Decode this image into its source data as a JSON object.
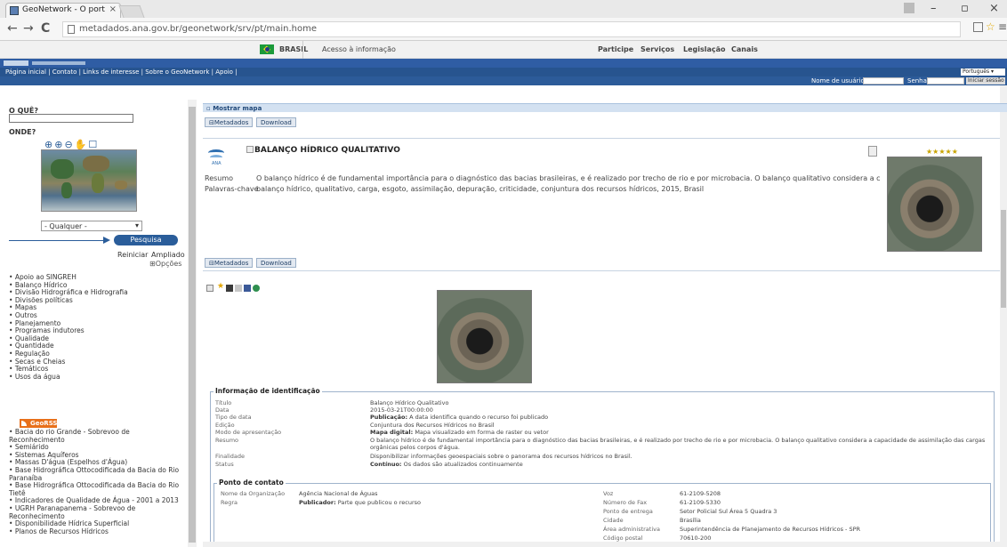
{
  "browser": {
    "tab_title": "GeoNetwork - O port",
    "url": "metadados.ana.gov.br/geonetwork/srv/pt/main.home"
  },
  "govbar": {
    "brasil": "BRASIL",
    "acesso": "Acesso à informação",
    "links": [
      "Participe",
      "Serviços",
      "Legislação",
      "Canais"
    ]
  },
  "header": {
    "nav": "Página inicial | Contato | Links de interesse | Sobre o GeoNetwork | Apoio |",
    "lang": "Português",
    "user_label": "Nome de usuário",
    "pass_label": "Senha",
    "login_label": "Iniciar sessão"
  },
  "sidebar": {
    "what": "O QUÊ?",
    "where": "ONDE?",
    "region": "- Qualquer -",
    "search": "Pesquisa",
    "reset": "Reiniciar",
    "advanced": "Ampliado",
    "options": "⊞Opções",
    "categories": [
      "Apoio ao SINGREH",
      "Balanço Hídrico",
      "Divisão Hidrográfica e Hidrografia",
      "Divisões políticas",
      "Mapas",
      "Outros",
      "Planejamento",
      "Programas indutores",
      "Qualidade",
      "Quantidade",
      "Regulação",
      "Secas e Cheias",
      "Temáticos",
      "Usos da água"
    ],
    "georss": "GeoRSS",
    "feeds": [
      "Bacia do rio Grande - Sobrevoo de Reconhecimento",
      "Semiárido",
      "Sistemas Aquíferos",
      "Massas D'água (Espelhos d'Água)",
      "Base Hidrográfica Ottocodificada da Bacia do Rio Paranaíba",
      "Base Hidrográfica Ottocodificada da Bacia do Rio Tietê",
      "Indicadores de Qualidade de Água - 2001 a 2013",
      "UGRH Paranapanema - Sobrevoo de Reconhecimento",
      "Disponibilidade Hídrica Superficial",
      "Planos de Recursos Hídricos"
    ]
  },
  "main": {
    "show_map": "Mostrar mapa",
    "metadados": "Metadados",
    "download": "Download",
    "logo_text": "ANA",
    "title": "BALANÇO HÍDRICO QUALITATIVO",
    "stars": "★★★★★",
    "resumo_label": "Resumo",
    "resumo": "O balanço hídrico é de fundamental importância para o diagnóstico das bacias brasileiras, e é realizado por trecho de rio e por microbacia. O balanço qualitativo considera a capacidade de assimilação...",
    "keywords_label": "Palavras-chave",
    "keywords": "balanço hídrico, qualitativo, carga, esgoto, assimilação, depuração, criticidade, conjuntura dos recursos hídricos, 2015, Brasil"
  },
  "ident": {
    "legend": "Informação de identificação",
    "rows": [
      {
        "k": "Título",
        "v": "Balanço Hídrico Qualitativo"
      },
      {
        "k": "Data",
        "v": "2015-03-21T00:00:00"
      },
      {
        "k": "Tipo de data",
        "b": "Publicação:",
        "v": "A data identifica quando o recurso foi publicado"
      },
      {
        "k": "Edição",
        "v": "Conjuntura dos Recursos Hídricos no Brasil"
      },
      {
        "k": "Modo de apresentação",
        "b": "Mapa digital:",
        "v": "Mapa visualizado em forma de raster ou vetor"
      },
      {
        "k": "Resumo",
        "v": "O balanço hídrico é de fundamental importância para o diagnóstico das bacias brasileiras, e é realizado por trecho de rio e por microbacia. O balanço qualitativo considera a capacidade de assimilação das cargas"
      },
      {
        "k": "",
        "v": "orgânicas pelos corpos d'água."
      },
      {
        "k": "Finalidade",
        "v": "Disponibilizar informações geoespaciais sobre o panorama dos recursos hídricos no Brasil."
      },
      {
        "k": "Status",
        "b": "Contínuo:",
        "v": "Os dados são atualizados continuamente"
      }
    ]
  },
  "contact": {
    "legend": "Ponto de contato",
    "org_label": "Nome da Organização",
    "org": "Agência Nacional de Águas",
    "role_label": "Regra",
    "role_b": "Publicador:",
    "role": "Parte que publicou o recurso",
    "right": [
      {
        "k": "Voz",
        "v": "61-2109-5208"
      },
      {
        "k": "Número de Fax",
        "v": "61-2109-5330"
      },
      {
        "k": "Ponto de entrega",
        "v": "Setor Policial Sul Área 5 Quadra 3"
      },
      {
        "k": "Cidade",
        "v": "Brasília"
      },
      {
        "k": "Área administrativa",
        "v": "Superintendência de Planejamento de Recursos Hídricos - SPR"
      },
      {
        "k": "Código postal",
        "v": "70610-200"
      }
    ]
  }
}
